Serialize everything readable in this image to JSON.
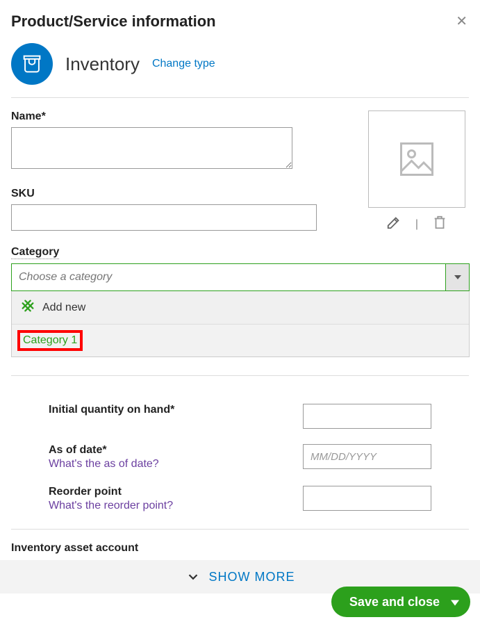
{
  "modal_title": "Product/Service information",
  "type": {
    "label": "Inventory",
    "change_link": "Change type"
  },
  "fields": {
    "name_label": "Name*",
    "sku_label": "SKU",
    "category_label": "Category",
    "category_placeholder": "Choose a category"
  },
  "category_dropdown": {
    "add_new": "Add new",
    "option1": "Category 1"
  },
  "inventory": {
    "initial_qty_label": "Initial quantity on hand*",
    "as_of_label": "As of date*",
    "as_of_help": "What's the as of date?",
    "as_of_placeholder": "MM/DD/YYYY",
    "reorder_label": "Reorder point",
    "reorder_help": "What's the reorder point?"
  },
  "asset_account_label": "Inventory asset account",
  "show_more": "SHOW MORE",
  "save_button": "Save and close"
}
